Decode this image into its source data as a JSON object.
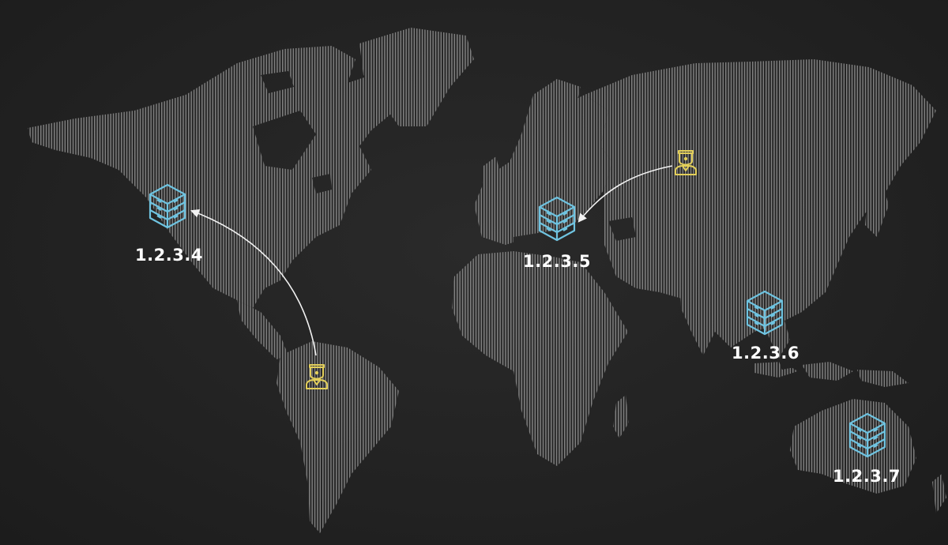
{
  "colors": {
    "background": "#222222",
    "land_stripes": "#7a7a7a",
    "server_icon": "#6fc3e0",
    "user_icon": "#e3cf5a",
    "arrow": "#f2f2f2",
    "label": "#ffffff"
  },
  "servers": [
    {
      "id": "na",
      "label": "1.2.3.4",
      "icon": "server-stack-icon"
    },
    {
      "id": "eu",
      "label": "1.2.3.5",
      "icon": "server-stack-icon"
    },
    {
      "id": "asia",
      "label": "1.2.3.6",
      "icon": "server-stack-icon"
    },
    {
      "id": "au",
      "label": "1.2.3.7",
      "icon": "server-stack-icon"
    }
  ],
  "users": [
    {
      "id": "south-america-user",
      "icon": "user-icon",
      "target": "1.2.3.4"
    },
    {
      "id": "russia-user",
      "icon": "user-icon",
      "target": "1.2.3.5"
    }
  ]
}
